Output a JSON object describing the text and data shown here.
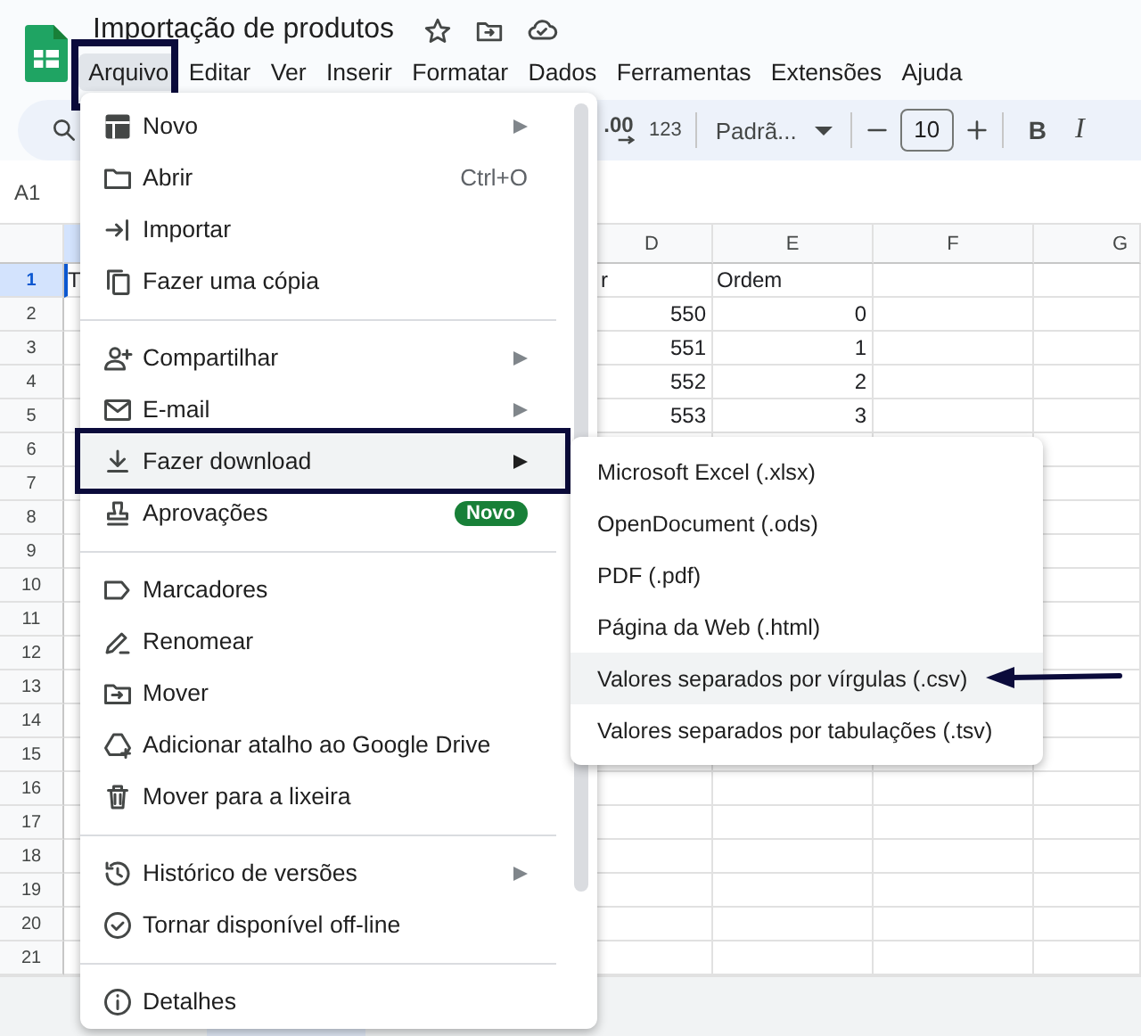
{
  "document": {
    "title": "Importação de produtos"
  },
  "menubar": [
    {
      "label": "Arquivo",
      "selected": true,
      "outlined": true
    },
    {
      "label": "Editar",
      "selected": false,
      "outlined": false
    },
    {
      "label": "Ver",
      "selected": false,
      "outlined": false
    },
    {
      "label": "Inserir",
      "selected": false,
      "outlined": false
    },
    {
      "label": "Formatar",
      "selected": false,
      "outlined": false
    },
    {
      "label": "Dados",
      "selected": false,
      "outlined": false
    },
    {
      "label": "Ferramentas",
      "selected": false,
      "outlined": false
    },
    {
      "label": "Extensões",
      "selected": false,
      "outlined": false
    },
    {
      "label": "Ajuda",
      "selected": false,
      "outlined": false
    }
  ],
  "toolbar": {
    "decimal_button": ".00",
    "number_format_button": "123",
    "font": "Padrã...",
    "font_size": "10",
    "bold_button": "B",
    "italic_button": "I"
  },
  "name_box": "A1",
  "grid": {
    "columns": [
      "D",
      "E",
      "F",
      "G"
    ],
    "rows": [
      {
        "number": "1",
        "selected": true,
        "first_cell": "T",
        "column_d": "r",
        "column_e": "Ordem"
      },
      {
        "number": "2",
        "selected": false,
        "column_d": "550",
        "column_e": "0"
      },
      {
        "number": "3",
        "selected": false,
        "column_d": "551",
        "column_e": "1"
      },
      {
        "number": "4",
        "selected": false,
        "column_d": "552",
        "column_e": "2"
      },
      {
        "number": "5",
        "selected": false,
        "column_d": "553",
        "column_e": "3"
      },
      {
        "number": "6",
        "selected": false
      },
      {
        "number": "7",
        "selected": false
      },
      {
        "number": "8",
        "selected": false
      },
      {
        "number": "9",
        "selected": false
      },
      {
        "number": "10",
        "selected": false
      },
      {
        "number": "11",
        "selected": false
      },
      {
        "number": "12",
        "selected": false
      },
      {
        "number": "13",
        "selected": false
      },
      {
        "number": "14",
        "selected": false
      },
      {
        "number": "15",
        "selected": false
      },
      {
        "number": "16",
        "selected": false
      },
      {
        "number": "17",
        "selected": false
      },
      {
        "number": "18",
        "selected": false
      },
      {
        "number": "19",
        "selected": false
      },
      {
        "number": "20",
        "selected": false
      },
      {
        "number": "21",
        "selected": false
      }
    ]
  },
  "file_menu": {
    "items": [
      {
        "kind": "item",
        "label": "Novo",
        "submenu": true,
        "selected": false,
        "outlined": false
      },
      {
        "kind": "item",
        "label": "Abrir",
        "shortcut": "Ctrl+O",
        "submenu": false,
        "selected": false,
        "outlined": false
      },
      {
        "kind": "item",
        "label": "Importar",
        "submenu": false,
        "selected": false,
        "outlined": false
      },
      {
        "kind": "item",
        "label": "Fazer uma cópia",
        "submenu": false,
        "selected": false,
        "outlined": false
      },
      {
        "kind": "divider"
      },
      {
        "kind": "item",
        "label": "Compartilhar",
        "submenu": true,
        "selected": false,
        "outlined": false
      },
      {
        "kind": "item",
        "label": "E-mail",
        "submenu": true,
        "selected": false,
        "outlined": false
      },
      {
        "kind": "item",
        "label": "Fazer download",
        "submenu": true,
        "selected": true,
        "outlined": true
      },
      {
        "kind": "item",
        "label": "Aprovações",
        "badge": "Novo",
        "submenu": false,
        "selected": false,
        "outlined": false
      },
      {
        "kind": "divider"
      },
      {
        "kind": "item",
        "label": "Marcadores",
        "submenu": false,
        "selected": false,
        "outlined": false
      },
      {
        "kind": "item",
        "label": "Renomear",
        "submenu": false,
        "selected": false,
        "outlined": false
      },
      {
        "kind": "item",
        "label": "Mover",
        "submenu": false,
        "selected": false,
        "outlined": false
      },
      {
        "kind": "item",
        "label": "Adicionar atalho ao Google Drive",
        "submenu": false,
        "selected": false,
        "outlined": false
      },
      {
        "kind": "item",
        "label": "Mover para a lixeira",
        "submenu": false,
        "selected": false,
        "outlined": false
      },
      {
        "kind": "divider"
      },
      {
        "kind": "item",
        "label": "Histórico de versões",
        "submenu": true,
        "selected": false,
        "outlined": false
      },
      {
        "kind": "item",
        "label": "Tornar disponível off-line",
        "submenu": false,
        "selected": false,
        "outlined": false
      },
      {
        "kind": "divider"
      },
      {
        "kind": "item",
        "label": "Detalhes",
        "submenu": false,
        "selected": false,
        "outlined": false
      }
    ]
  },
  "download_submenu": {
    "items": [
      {
        "label": "Microsoft Excel (.xlsx)",
        "selected": false
      },
      {
        "label": "OpenDocument (.ods)",
        "selected": false
      },
      {
        "label": "PDF (.pdf)",
        "selected": false
      },
      {
        "label": "Página da Web (.html)",
        "selected": false
      },
      {
        "label": "Valores separados por vírgulas (.csv)",
        "selected": true
      },
      {
        "label": "Valores separados por tabulações (.tsv)",
        "selected": false
      }
    ]
  }
}
